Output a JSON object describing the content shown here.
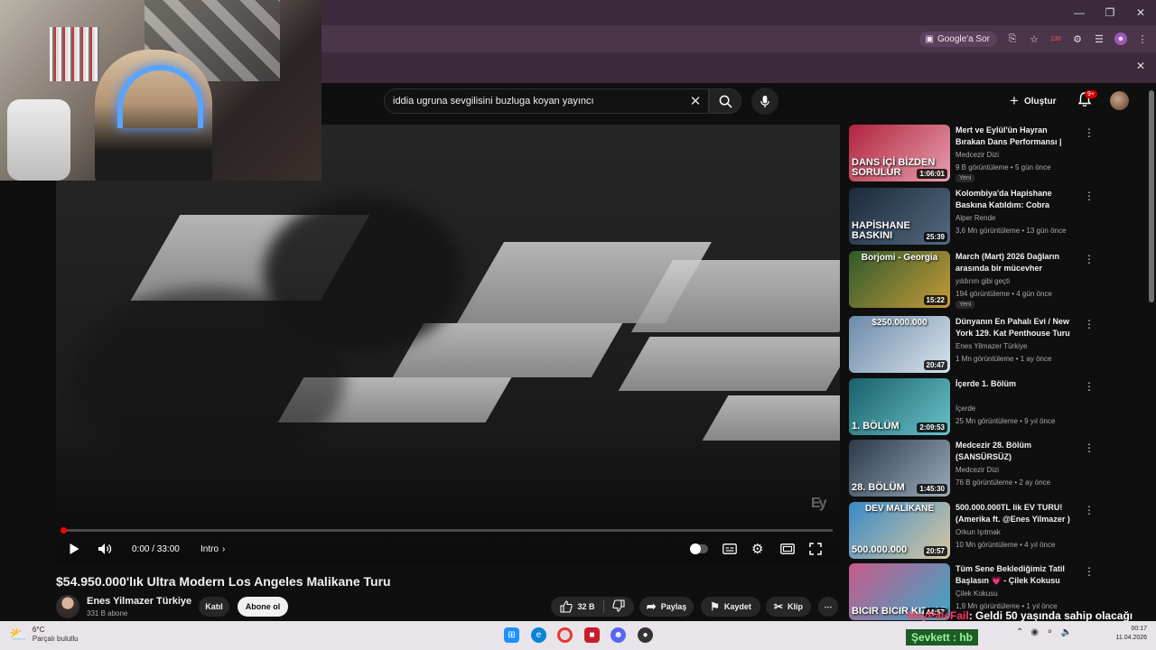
{
  "browser": {
    "ask_google": "Google'a Sor",
    "notif_count_ext": "136"
  },
  "search": {
    "query": "iddia ugruna sevgilisini buzluga koyan yayıncı"
  },
  "top": {
    "create_label": "Oluştur",
    "bell_badge": "9+"
  },
  "player": {
    "time": "0:00 / 33:00",
    "chapter": "Intro",
    "watermark": "Ey"
  },
  "video": {
    "title": "$54.950.000'lık Ultra Modern Los Angeles Malikane Turu",
    "channel": "Enes Yilmazer Türkiye",
    "subs": "331 B abone",
    "join_label": "Katıl",
    "subscribe_label": "Abone ol",
    "likes": "32 B",
    "share_label": "Paylaş",
    "save_label": "Kaydet",
    "clip_label": "Klip"
  },
  "recommendations": [
    {
      "title": "Mert ve Eylül'ün Hayran Bırakan Dans Performansı | Medcezir",
      "channel": "Medcezir Dizi",
      "meta": "9 B görüntüleme • 5 gün önce",
      "duration": "1:06:01",
      "badge": "Yeni",
      "thumb_text": "DANS İÇİ BİZDEN SORULUR",
      "colors": [
        "#b0233c",
        "#e8a0b0"
      ]
    },
    {
      "title": "Kolombiya'da Hapishane Baskına Katıldım: Cobra Commandos",
      "channel": "Alper Rende",
      "meta": "3,6 Mn görüntüleme • 13 gün önce",
      "duration": "25:39",
      "badge": "",
      "thumb_text": "HAPİSHANE BASKINI",
      "colors": [
        "#1a2a3a",
        "#546a80"
      ]
    },
    {
      "title": "March (Mart) 2026 Dağların arasında bir mücevher (Borjomi)",
      "channel": "yıldırım gibi geçti",
      "meta": "194 görüntüleme • 4 gün önce",
      "duration": "15:22",
      "badge": "Yeni",
      "thumb_text": "",
      "thumb_top": "Borjomi - Georgia",
      "colors": [
        "#2e5a2a",
        "#c79a3a"
      ]
    },
    {
      "title": "Dünyanın En Pahalı Evi / New York 129. Kat Penthouse Turu",
      "channel": "Enes Yilmazer Türkiye",
      "meta": "1 Mn görüntüleme • 1 ay önce",
      "duration": "20:47",
      "badge": "",
      "thumb_text": "",
      "thumb_top": "$250.000.000",
      "colors": [
        "#6b8aa8",
        "#d9e4ee"
      ]
    },
    {
      "title": "İçerde 1. Bölüm",
      "channel": "İçerde",
      "meta": "25 Mn görüntüleme • 9 yıl önce",
      "duration": "2:09:53",
      "badge": "",
      "thumb_text": "1. BÖLÜM",
      "colors": [
        "#18606a",
        "#6ac2c8"
      ]
    },
    {
      "title": "Medcezir 28. Bölüm (SANSÜRSÜZ)",
      "channel": "Medcezir Dizi",
      "meta": "76 B görüntüleme • 2 ay önce",
      "duration": "1:45:30",
      "badge": "",
      "thumb_text": "28. BÖLÜM",
      "colors": [
        "#2a3a4a",
        "#9aaabb"
      ]
    },
    {
      "title": "500.000.000TL lik EV TURU! (Amerika ft. @Enes Yilmazer )",
      "channel": "Orkun Işıtmak",
      "meta": "10 Mn görüntüleme • 4 yıl önce",
      "duration": "20:57",
      "badge": "",
      "thumb_text": "500.000.000",
      "thumb_top": "DEV MALİKANE",
      "colors": [
        "#3a8ac8",
        "#d8c8a0"
      ]
    },
    {
      "title": "Tüm Sene Beklediğimiz Tatil Başlasın 💗 - Çilek Kokusu",
      "channel": "Çilek Kokusu",
      "meta": "1,9 Mn görüntüleme • 1 yıl önce",
      "duration": "44:57",
      "badge": "",
      "thumb_text": "BICIR BICIR KIZLAR",
      "colors": [
        "#c85a8a",
        "#38a8c8"
      ]
    }
  ],
  "chat": {
    "user": "MayPaleFail",
    "message": ": Geldi 50 yaşında sahip olacağı"
  },
  "taskbar": {
    "temp": "6°C",
    "weather": "Parçalı bulutlu",
    "streamer": "Şevkett : hb",
    "time": "00:17",
    "date": "11.04.2026"
  }
}
